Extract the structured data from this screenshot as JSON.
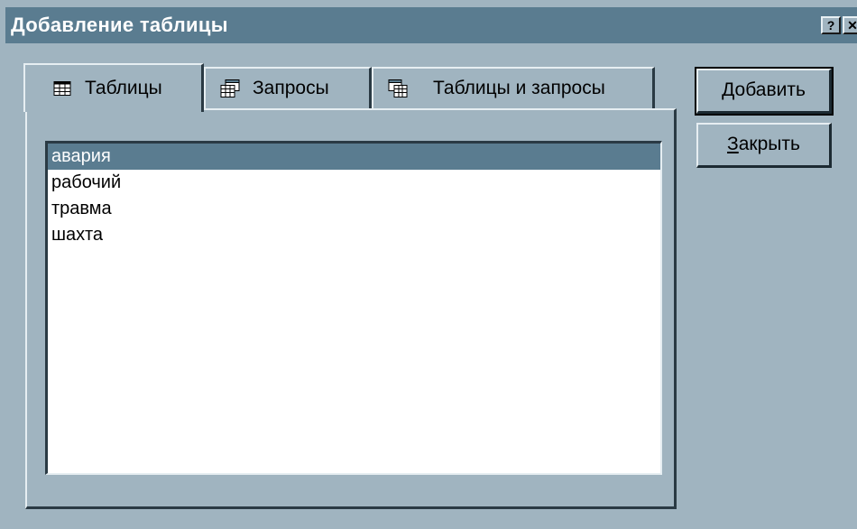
{
  "window": {
    "title": "Добавление таблицы",
    "help_glyph": "?",
    "close_glyph": "✕"
  },
  "tabs": [
    {
      "label": "Таблицы",
      "icon": "table-icon",
      "active": true
    },
    {
      "label": "Запросы",
      "icon": "query-icon",
      "active": false
    },
    {
      "label": "Таблицы и запросы",
      "icon": "tables-and-queries-icon",
      "active": false
    }
  ],
  "list": {
    "items": [
      "авария",
      "рабочий",
      "травма",
      "шахта"
    ],
    "selected_index": 0
  },
  "buttons": {
    "add": {
      "mnemonic": "Д",
      "rest": "обавить"
    },
    "close": {
      "mnemonic": "З",
      "rest": "акрыть"
    }
  },
  "colors": {
    "face": "#a0b4c0",
    "titlebar": "#5a7c90",
    "selection": "#5a7c90"
  }
}
